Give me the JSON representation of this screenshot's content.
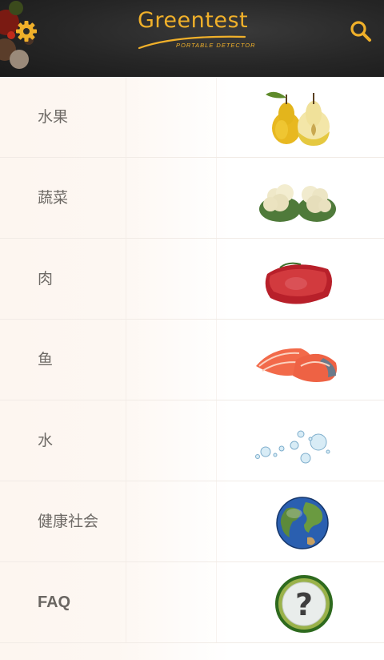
{
  "header": {
    "logo_text": "Greentest",
    "logo_subtitle": "PORTABLE DETECTOR",
    "settings_icon": "gear-icon",
    "search_icon": "search-icon",
    "accent_color": "#f0b02a"
  },
  "categories": [
    {
      "label": "水果",
      "icon": "pear-image"
    },
    {
      "label": "蔬菜",
      "icon": "cauliflower-image"
    },
    {
      "label": "肉",
      "icon": "meat-image"
    },
    {
      "label": "鱼",
      "icon": "salmon-image"
    },
    {
      "label": "水",
      "icon": "water-drops-image"
    },
    {
      "label": "健康社会",
      "icon": "globe-image"
    },
    {
      "label": "FAQ",
      "icon": "question-button-image"
    }
  ]
}
